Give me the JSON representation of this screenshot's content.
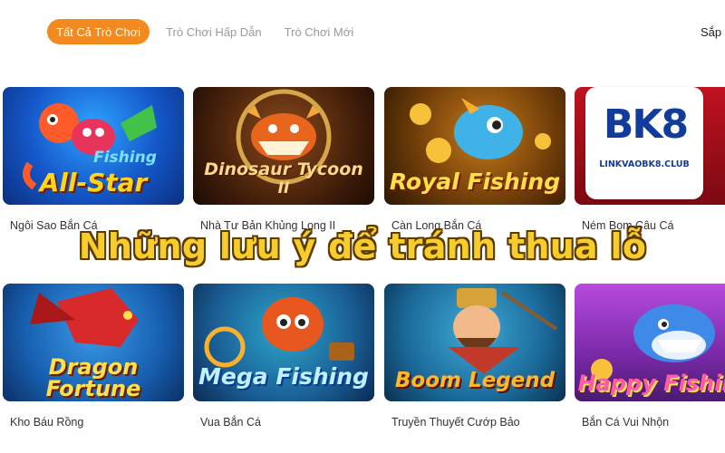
{
  "tabs": [
    {
      "label": "Tất Cả Trò Chơi",
      "active": true
    },
    {
      "label": "Trò Chơi Hấp Dẫn",
      "active": false
    },
    {
      "label": "Trò Chơi Mới",
      "active": false
    }
  ],
  "sort_label": "Sắp",
  "accent_color": "#f28a1f",
  "games": [
    {
      "caption": "Ngôi Sao Bắn Cá",
      "art_title": "All-Star",
      "art_subtitle": "Fishing"
    },
    {
      "caption": "Nhà Tư Bản Khủng Long II",
      "art_title": "Dinosaur Tycoon",
      "art_subtitle": "II"
    },
    {
      "caption": "Càn Long Bắn Cá",
      "art_title": "Royal Fishing"
    },
    {
      "caption": "Ném Bom Câu Cá"
    },
    {
      "caption": "Kho Báu Rồng",
      "art_title": "Dragon Fortune"
    },
    {
      "caption": "Vua Bắn Cá",
      "art_title": "Mega Fishing"
    },
    {
      "caption": "Truyền Thuyết Cướp Bảo",
      "art_title": "Boom Legend"
    },
    {
      "caption": "Bắn Cá Vui Nhộn",
      "art_title": "Happy Fishing"
    }
  ],
  "banner": "Những lưu ý để tránh thua lỗ",
  "logo": {
    "mark": "BK8",
    "sub": "LINKVAOBK8.CLUB"
  }
}
